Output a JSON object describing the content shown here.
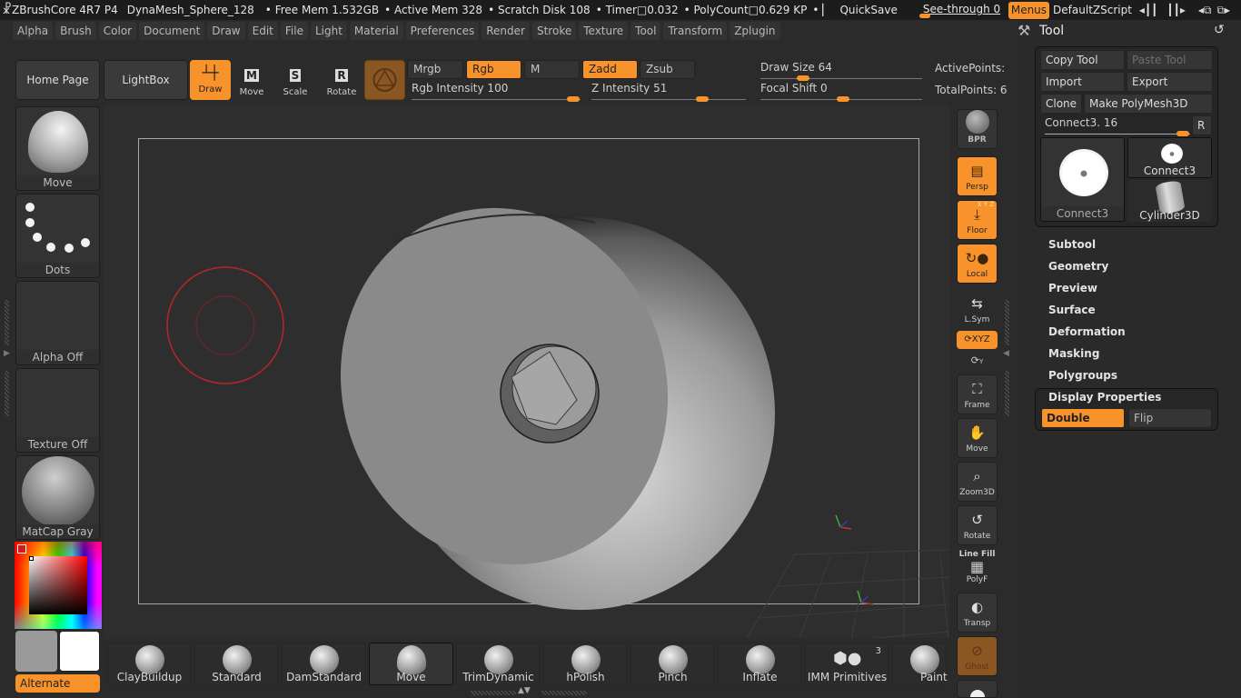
{
  "titlebar": {
    "app": "ZBrushCore 4R7 P4",
    "document": "DynaMesh_Sphere_128",
    "free_mem": "• Free Mem 1.532GB",
    "active_mem": "• Active Mem 328",
    "scratch_disk": "• Scratch Disk 108",
    "timer": "• Timer□0.032",
    "polycount": "• PolyCount□0.629 KP",
    "trunc": "• ▏",
    "quicksave": "QuickSave",
    "see_through": "See-through  0",
    "see_through_value": 0,
    "menus": "Menus",
    "script": "DefaultZScript",
    "icons": [
      "scroll-left-icon",
      "scroll-right-icon",
      "layout-prev-icon",
      "layout-next-icon",
      "lock-icon",
      "minimize-icon",
      "restore-icon",
      "close-icon"
    ]
  },
  "menubar": [
    "Alpha",
    "Brush",
    "Color",
    "Document",
    "Draw",
    "Edit",
    "File",
    "Light",
    "Material",
    "Preferences",
    "Render",
    "Stroke",
    "Texture",
    "Tool",
    "Transform",
    "Zplugin"
  ],
  "toolbar": {
    "home_page": "Home Page",
    "lightbox": "LightBox",
    "draw": "Draw",
    "move": "Move",
    "scale": "Scale",
    "rotate": "Rotate",
    "move_key": "M",
    "scale_key": "S",
    "rotate_key": "R",
    "mrgb": "Mrgb",
    "rgb": "Rgb",
    "m": "M",
    "zadd": "Zadd",
    "zsub": "Zsub",
    "rgb_intensity": "Rgb Intensity 100",
    "rgb_intensity_value": 100,
    "z_intensity": "Z Intensity 51",
    "z_intensity_value": 51,
    "draw_size": "Draw Size 64",
    "draw_size_value": 64,
    "focal_shift": "Focal Shift 0",
    "focal_shift_value": 0,
    "active_points": "ActivePoints:",
    "total_points": "TotalPoints: 6"
  },
  "left_shelf": {
    "brush": "Move",
    "stroke": "Dots",
    "alpha": "Alpha Off",
    "texture": "Texture Off",
    "material": "MatCap Gray",
    "alternate": "Alternate",
    "main_color": "#c81e1e",
    "primary_swatch": "#9a9a9a",
    "secondary_swatch": "#ffffff"
  },
  "right_shelf": [
    "BPR",
    "Persp",
    "Floor",
    "Local",
    "L.Sym",
    "XYZ",
    "Y",
    "Frame",
    "Move",
    "Zoom3D",
    "Rotate",
    "PolyF",
    "Transp",
    "Ghost"
  ],
  "right_shelf_extra": {
    "line_fill": "Line Fill",
    "floor_axes": "X Y Z"
  },
  "tool_panel": {
    "title": "Tool",
    "copy_tool": "Copy Tool",
    "paste_tool": "Paste Tool",
    "import": "Import",
    "export": "Export",
    "clone": "Clone",
    "make_polymesh": "Make PolyMesh3D",
    "tool_slider": "Connect3. 16",
    "tool_slider_value": 16,
    "r_button": "R",
    "thumbs": [
      "Connect3",
      "Connect3",
      "Cylinder3D"
    ],
    "sections": [
      "Subtool",
      "Geometry",
      "Preview",
      "Surface",
      "Deformation",
      "Masking",
      "Polygroups"
    ],
    "display_properties": "Display Properties",
    "double": "Double",
    "flip": "Flip"
  },
  "brush_shelf": [
    {
      "label": "ClayBuildup"
    },
    {
      "label": "Standard"
    },
    {
      "label": "DamStandard"
    },
    {
      "label": "Move",
      "selected": true
    },
    {
      "label": "TrimDynamic"
    },
    {
      "label": "hPolish"
    },
    {
      "label": "Pinch"
    },
    {
      "label": "Inflate"
    },
    {
      "label": "IMM Primitives",
      "badge": "3"
    },
    {
      "label": "Paint"
    }
  ],
  "colors": {
    "accent": "#f7932a",
    "bg": "#2b2b2b",
    "brush_cursor": "#b5262a"
  }
}
